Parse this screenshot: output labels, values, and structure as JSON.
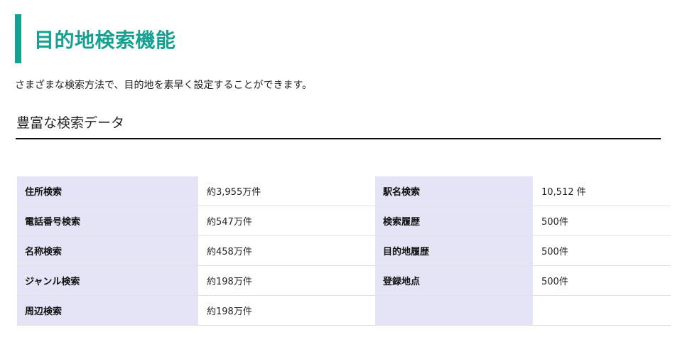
{
  "page": {
    "title": "目的地検索機能",
    "intro": "さまざまな検索方法で、目的地を素早く設定することができます。",
    "section_title": "豊富な検索データ",
    "accent_color": "#17a091",
    "label_bg_color": "#e5e4f7"
  },
  "table": {
    "left": [
      {
        "label": "住所検索",
        "value": "約3,955万件"
      },
      {
        "label": "電話番号検索",
        "value": "約547万件"
      },
      {
        "label": "名称検索",
        "value": "約458万件"
      },
      {
        "label": "ジャンル検索",
        "value": "約198万件"
      },
      {
        "label": "周辺検索",
        "value": "約198万件"
      }
    ],
    "right": [
      {
        "label": "駅名検索",
        "value": "10,512 件"
      },
      {
        "label": "検索履歴",
        "value": "500件"
      },
      {
        "label": "目的地履歴",
        "value": "500件"
      },
      {
        "label": "登録地点",
        "value": "500件"
      },
      {
        "label": "",
        "value": ""
      }
    ]
  }
}
